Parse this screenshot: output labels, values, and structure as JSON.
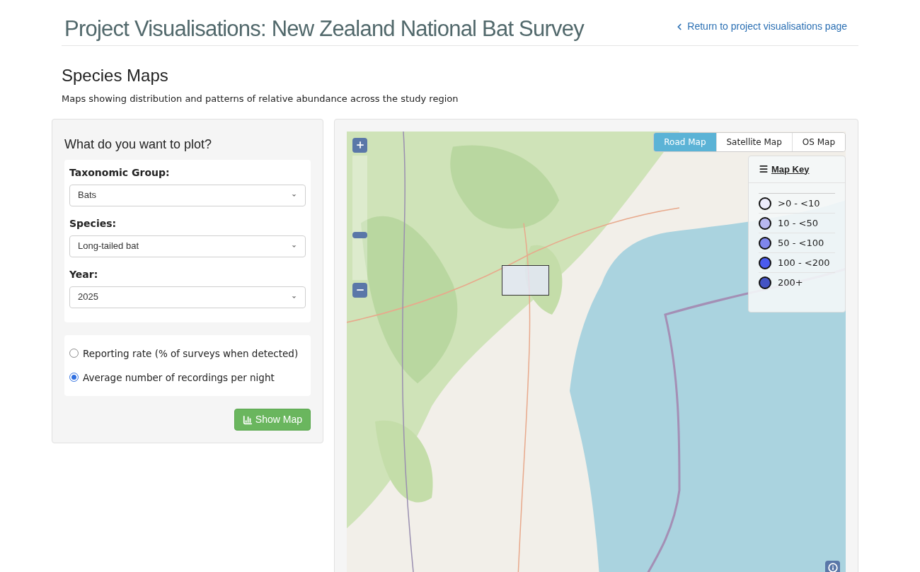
{
  "header": {
    "title": "Project Visualisations: New Zealand National Bat Survey",
    "back_link": "Return to project visualisations page"
  },
  "section": {
    "title": "Species Maps",
    "subtitle": "Maps showing distribution and patterns of relative abundance across the study region"
  },
  "form": {
    "title": "What do you want to plot?",
    "selects": [
      {
        "label": "Taxonomic Group:",
        "value": "Bats"
      },
      {
        "label": "Species:",
        "value": "Long-tailed bat"
      },
      {
        "label": "Year:",
        "value": "2025"
      }
    ],
    "measures": [
      {
        "label": "Reporting rate (% of surveys when detected)",
        "selected": false
      },
      {
        "label": "Average number of recordings per night",
        "selected": true
      }
    ],
    "submit": "Show Map"
  },
  "map": {
    "zoom_slider": {
      "level": 0.35
    },
    "layers": [
      {
        "label": "Road Map",
        "selected": true
      },
      {
        "label": "Satellite Map",
        "selected": false
      },
      {
        "label": "OS Map",
        "selected": false
      }
    ],
    "key": {
      "title": "Map Key",
      "items": [
        {
          "label": ">0 - <10",
          "color": "#ececfc"
        },
        {
          "label": "10 - <50",
          "color": "#b8b8f0"
        },
        {
          "label": "50 - <100",
          "color": "#7f86ec"
        },
        {
          "label": "100 - <200",
          "color": "#4a5bee"
        },
        {
          "label": "200+",
          "color": "#4453c4"
        }
      ]
    }
  }
}
